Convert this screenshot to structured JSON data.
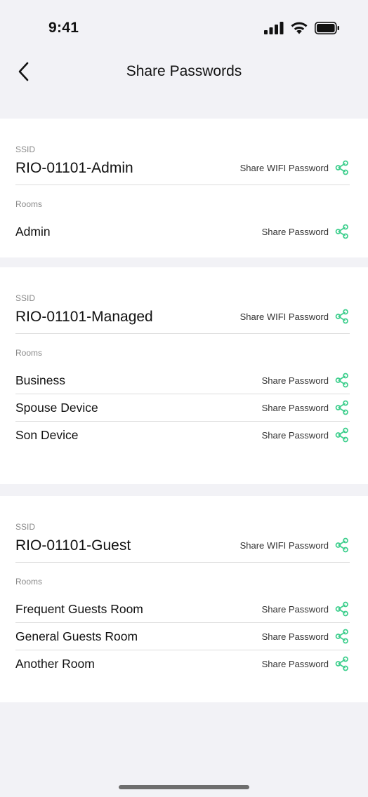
{
  "status_bar": {
    "time": "9:41"
  },
  "nav": {
    "title": "Share Passwords"
  },
  "accent_color": "#3fcf8e",
  "icons": {
    "back": "chevron-left-icon",
    "share": "share-icon",
    "signal": "signal-icon",
    "wifi": "wifi-icon",
    "battery": "battery-icon"
  },
  "networks": [
    {
      "ssid_label": "SSID",
      "ssid": "RIO-01101-Admin",
      "share_wifi_label": "Share WIFI Password",
      "rooms_label": "Rooms",
      "rooms": [
        {
          "name": "Admin",
          "share_label": "Share Password"
        }
      ]
    },
    {
      "ssid_label": "SSID",
      "ssid": "RIO-01101-Managed",
      "share_wifi_label": "Share WIFI Password",
      "rooms_label": "Rooms",
      "rooms": [
        {
          "name": "Business",
          "share_label": "Share Password"
        },
        {
          "name": "Spouse Device",
          "share_label": "Share Password"
        },
        {
          "name": "Son Device",
          "share_label": "Share Password"
        }
      ]
    },
    {
      "ssid_label": "SSID",
      "ssid": "RIO-01101-Guest",
      "share_wifi_label": "Share WIFI Password",
      "rooms_label": "Rooms",
      "rooms": [
        {
          "name": "Frequent Guests Room",
          "share_label": "Share Password"
        },
        {
          "name": "General Guests Room",
          "share_label": "Share Password"
        },
        {
          "name": "Another Room",
          "share_label": "Share Password"
        }
      ]
    }
  ]
}
